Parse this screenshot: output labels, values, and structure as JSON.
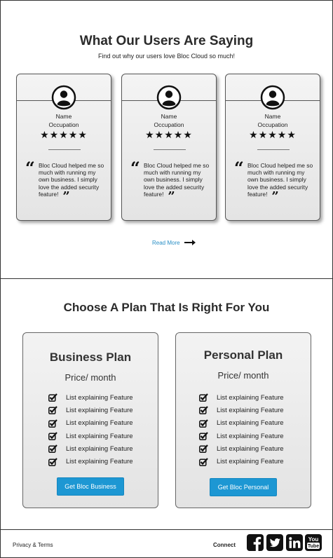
{
  "testimonials": {
    "title": "What Our Users Are Saying",
    "subtitle": "Find out why our users love Bloc Cloud so much!",
    "cards": [
      {
        "name": "Name",
        "occupation": "Occupation",
        "stars": "★★★★★",
        "quote": "Bloc Cloud helped me so much with running my own business. I simply love the added security feature!"
      },
      {
        "name": "Name",
        "occupation": "Occupation",
        "stars": "★★★★★",
        "quote": "Bloc Cloud helped me so much with running my own business. I simply love the added security feature!"
      },
      {
        "name": "Name",
        "occupation": "Occupation",
        "stars": "★★★★★",
        "quote": "Bloc Cloud helped me so much with running my own business. I simply love the added security feature!"
      }
    ],
    "read_more": "Read More"
  },
  "plans": {
    "title": "Choose A Plan That Is Right For You",
    "items": [
      {
        "name": "Business Plan",
        "price": "Price/ month",
        "features": [
          "List explaining Feature",
          "List explaining Feature",
          "List explaining Feature",
          "List explaining Feature",
          "List explaining Feature",
          "List explaining Feature"
        ],
        "button": "Get Bloc Business"
      },
      {
        "name": "Personal Plan",
        "price": "Price/ month",
        "features": [
          "List explaining Feature",
          "List explaining Feature",
          "List explaining Feature",
          "List explaining Feature",
          "List explaining Feature",
          "List explaining Feature"
        ],
        "button": "Get Bloc Personal"
      }
    ]
  },
  "footer": {
    "privacy_terms": "Privacy & Terms",
    "connect": "Connect",
    "social_icons": [
      "facebook-icon",
      "twitter-icon",
      "linkedin-icon",
      "youtube-icon"
    ],
    "youtube_text_top": "You",
    "youtube_text_bottom": "Tube"
  },
  "colors": {
    "accent": "#1d97d3",
    "link": "#2a8fc6"
  }
}
